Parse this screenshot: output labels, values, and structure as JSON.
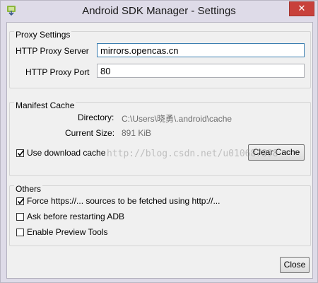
{
  "window": {
    "title": "Android SDK Manager - Settings",
    "close_glyph": "✕"
  },
  "proxy": {
    "group_label": "Proxy Settings",
    "server_label": "HTTP Proxy Server",
    "server_value": "mirrors.opencas.cn",
    "port_label": "HTTP Proxy Port",
    "port_value": "80"
  },
  "manifest": {
    "group_label": "Manifest Cache",
    "directory_label": "Directory:",
    "directory_value": "C:\\Users\\晓勇\\.android\\cache",
    "size_label": "Current Size:",
    "size_value": "891 KiB",
    "use_cache_label": "Use download cache",
    "use_cache_checked": true,
    "clear_button": "Clear Cache"
  },
  "others": {
    "group_label": "Others",
    "options": [
      {
        "label": "Force https://... sources to be fetched using http://...",
        "checked": true
      },
      {
        "label": "Ask before restarting ADB",
        "checked": false
      },
      {
        "label": "Enable Preview Tools",
        "checked": false
      }
    ]
  },
  "footer": {
    "close_button": "Close"
  },
  "watermark": "http://blog.csdn.net/u010687898",
  "colors": {
    "titlebar": "#dedbe8",
    "close_button_red": "#c8413b",
    "client_bg": "#f0f0f0"
  },
  "icons": [
    "android-sdk-app-icon",
    "close-icon",
    "checkmark-icon"
  ]
}
